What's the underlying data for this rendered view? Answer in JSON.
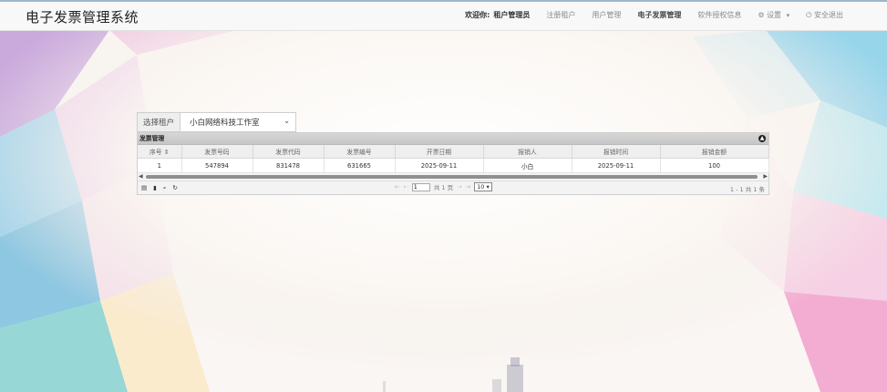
{
  "header": {
    "brand": "电子发票管理系统",
    "welcome_prefix": "欢迎你:",
    "welcome_user": "租户管理员",
    "nav": [
      {
        "label": "注册租户"
      },
      {
        "label": "用户管理"
      },
      {
        "label": "电子发票管理"
      },
      {
        "label": "软件授权信息"
      },
      {
        "label": "设置"
      },
      {
        "label": "安全退出"
      }
    ]
  },
  "tenant": {
    "label": "选择租户",
    "selected": "小白网络科技工作室"
  },
  "grid": {
    "caption": "发票管理",
    "columns": [
      "序号",
      "发票号码",
      "发票代码",
      "发票编号",
      "开票日期",
      "报销人",
      "报销时间",
      "报销金额"
    ],
    "rows": [
      [
        "1",
        "547894",
        "831478",
        "631665",
        "2025-09-11",
        "小白",
        "2025-09-11",
        "100"
      ]
    ],
    "pager": {
      "page_value": "1",
      "total_pages_text": "共 1 页",
      "rows_per_page": "10",
      "record_text": "1 - 1  共 1 条"
    }
  },
  "colors": {
    "header_bg": "#f8f8f8",
    "header_accent": "#9ab8d0",
    "grid_caption_bg": "#cfcfcf"
  },
  "icons": [
    "gear-icon",
    "power-icon",
    "add-icon",
    "delete-icon",
    "search-icon",
    "refresh-icon"
  ]
}
